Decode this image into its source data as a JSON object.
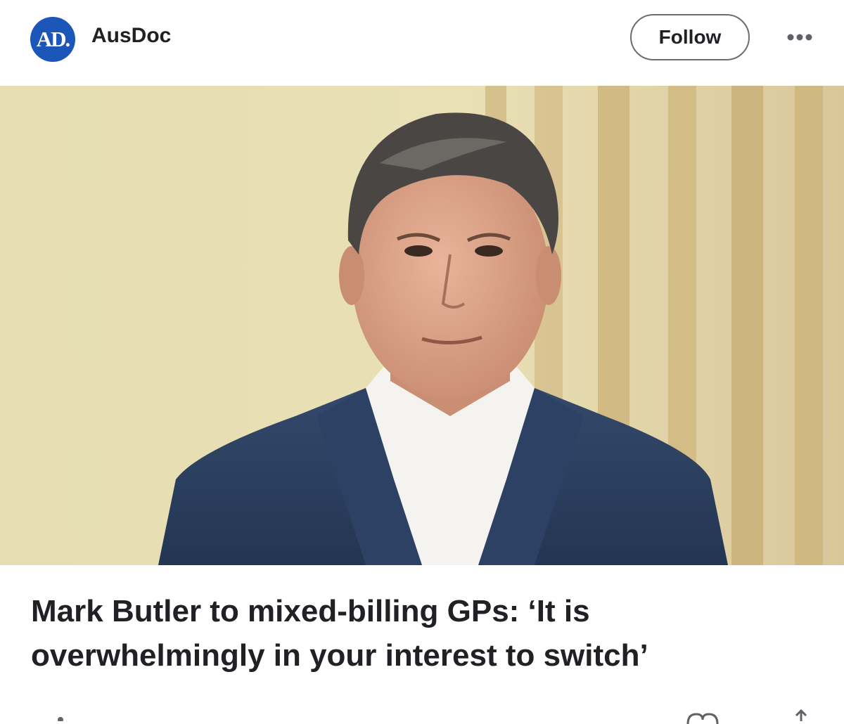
{
  "header": {
    "logo_text": "AD.",
    "source_name": "AusDoc",
    "follow_label": "Follow",
    "more_icon": "more-horizontal-icon"
  },
  "article": {
    "image_icon": "portrait-photo",
    "headline": "Mark Butler to mixed-billing GPs: ‘It is overwhelmingly in your interest to switch’"
  },
  "footer": {
    "icons": [
      "heart-icon",
      "share-icon"
    ]
  },
  "colors": {
    "logo_bg": "#1c56b8",
    "text": "#202124",
    "wall": "#e8dfb4",
    "suit": "#2a3e5e"
  }
}
